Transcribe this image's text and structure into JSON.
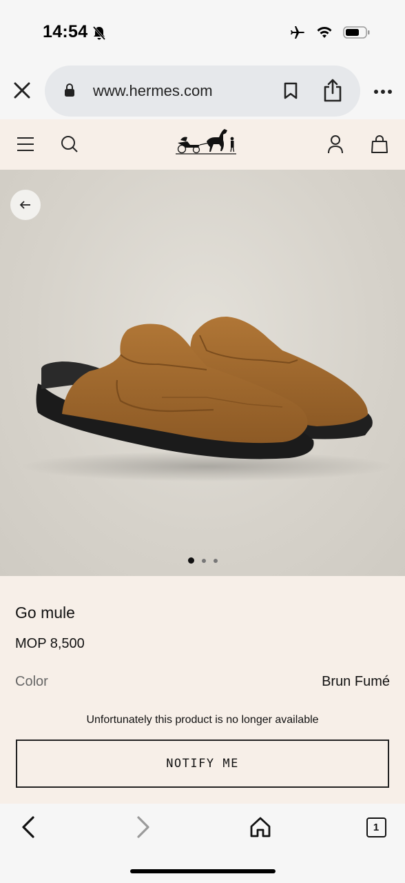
{
  "status_bar": {
    "time": "14:54",
    "icons": [
      "bell-slash-icon",
      "airplane-icon",
      "wifi-icon",
      "battery-icon"
    ]
  },
  "browser": {
    "url": "www.hermes.com",
    "icons": [
      "close-icon",
      "lock-icon",
      "bookmark-icon",
      "share-icon",
      "more-icon"
    ]
  },
  "site_header": {
    "icons": [
      "menu-icon",
      "search-icon",
      "hermes-logo",
      "account-icon",
      "shopping-bag-icon"
    ]
  },
  "gallery": {
    "image_count": 3,
    "active_index": 0,
    "colors": {
      "shoe": "#a0672e",
      "sole": "#1f1f1f",
      "background": "#d8d4cc"
    }
  },
  "product": {
    "name": "Go mule",
    "price": "MOP 8,500",
    "color_label": "Color",
    "color_value": "Brun Fumé",
    "availability_message": "Unfortunately this product is no longer available",
    "notify_label": "NOTIFY ME"
  },
  "toolbar": {
    "tab_count": "1",
    "icons": [
      "back-icon",
      "forward-icon",
      "home-icon",
      "tabs-icon"
    ]
  },
  "colors": {
    "site_bg": "#f7efe8",
    "browser_bg": "#f6f6f6",
    "url_pill": "#e6e8eb"
  }
}
